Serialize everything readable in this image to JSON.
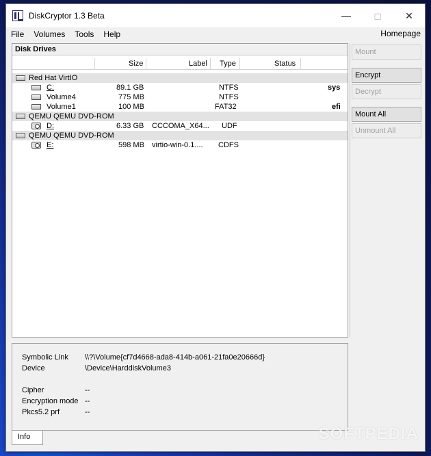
{
  "window": {
    "title": "DiskCryptor 1.3 Beta"
  },
  "menu": {
    "items": [
      "File",
      "Volumes",
      "Tools",
      "Help"
    ],
    "homepage": "Homepage"
  },
  "drives_panel": {
    "title": "Disk Drives",
    "columns": [
      "Size",
      "Label",
      "Type",
      "Status"
    ],
    "groups": [
      {
        "name": "Red Hat VirtIO",
        "rows": [
          {
            "name": "C:",
            "size": "89.1 GB",
            "label": "",
            "type": "NTFS",
            "status": "sys",
            "icon": "disk-icon"
          },
          {
            "name": "Volume4",
            "size": "775 MB",
            "label": "",
            "type": "NTFS",
            "status": "",
            "icon": "disk-icon"
          },
          {
            "name": "Volume1",
            "size": "100 MB",
            "label": "",
            "type": "FAT32",
            "status": "efi",
            "icon": "disk-icon"
          }
        ]
      },
      {
        "name": "QEMU QEMU DVD-ROM",
        "rows": [
          {
            "name": "D:",
            "size": "6.33 GB",
            "label": "CCCOMA_X64...",
            "type": "UDF",
            "status": "",
            "icon": "cdrom-icon"
          }
        ]
      },
      {
        "name": "QEMU QEMU DVD-ROM",
        "rows": [
          {
            "name": "E:",
            "size": "598 MB",
            "label": "virtio-win-0.1....",
            "type": "CDFS",
            "status": "",
            "icon": "cdrom-icon"
          }
        ]
      }
    ]
  },
  "buttons": {
    "mount": "Mount",
    "encrypt": "Encrypt",
    "decrypt": "Decrypt",
    "mount_all": "Mount All",
    "unmount_all": "Unmount All"
  },
  "info": {
    "symbolic_link_label": "Symbolic Link",
    "symbolic_link_value": "\\\\?\\Volume{cf7d4668-ada8-414b-a061-21fa0e20666d}",
    "device_label": "Device",
    "device_value": "\\Device\\HarddiskVolume3",
    "cipher_label": "Cipher",
    "cipher_value": "--",
    "encryption_mode_label": "Encryption mode",
    "encryption_mode_value": "--",
    "pkcs_label": "Pkcs5.2 prf",
    "pkcs_value": "--"
  },
  "tabs": {
    "info": "Info"
  },
  "watermark": "SOFTPEDIA"
}
